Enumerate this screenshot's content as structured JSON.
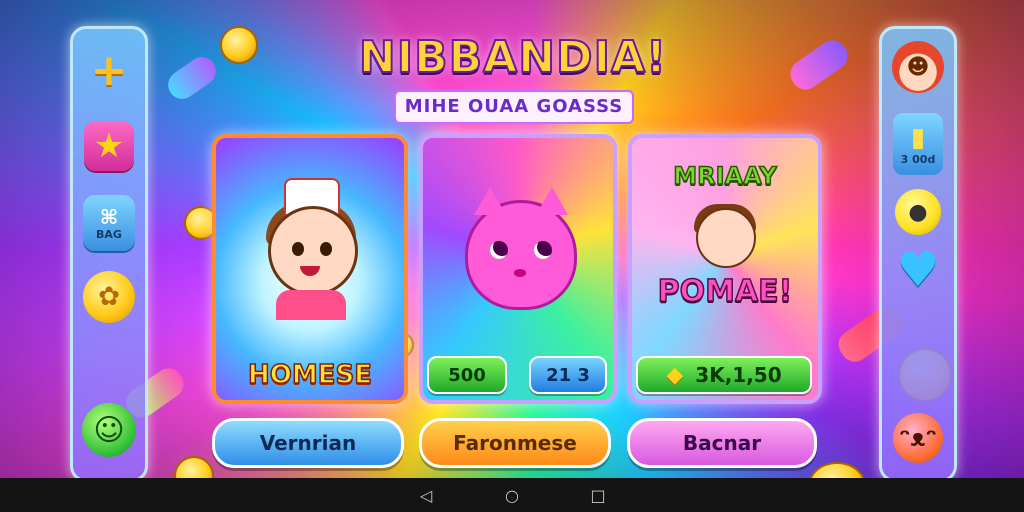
{
  "game": {
    "title": "NIBBANDIA!",
    "subtitle": "MIHE OUAA GOASSS"
  },
  "left_panel": {
    "items": [
      {
        "icon": "plus-icon",
        "glyph": "+"
      },
      {
        "icon": "star-icon",
        "glyph": "★"
      },
      {
        "icon": "bag-icon",
        "glyph": "⌘",
        "label": "BAG"
      },
      {
        "icon": "coin-icon",
        "glyph": "✿"
      },
      {
        "icon": "smiley-icon",
        "glyph": "☺"
      }
    ]
  },
  "right_panel": {
    "items": [
      {
        "icon": "girl-avatar-icon",
        "glyph": "☻"
      },
      {
        "icon": "cup-icon",
        "glyph": "▮",
        "label": "3 00d"
      },
      {
        "icon": "chick-icon",
        "glyph": "●"
      },
      {
        "icon": "heart-icon",
        "glyph": "♥"
      },
      {
        "icon": "cat-face-icon",
        "glyph": "ᵔᴥᵔ"
      }
    ]
  },
  "cards": [
    {
      "label": "HOMESE"
    },
    {
      "left_value": "500",
      "right_value": "21 3"
    },
    {
      "top_text": "MRIAAY",
      "mid_text": "POMAE!",
      "value": "3K,1,50",
      "gem_glyph": "◆"
    }
  ],
  "buttons": {
    "left": "Vernrian",
    "center": "Faronmese",
    "right": "Bacnar"
  },
  "navbar": {
    "back": "◁",
    "home": "○",
    "recents": "□"
  },
  "colors": {
    "title_gradient": [
      "#ffe44a",
      "#ff9a2a",
      "#ff4fb0",
      "#8ad84a"
    ],
    "button_left": "#2f8ee8",
    "button_center": "#ff8a1a",
    "button_right": "#d85ae0"
  }
}
